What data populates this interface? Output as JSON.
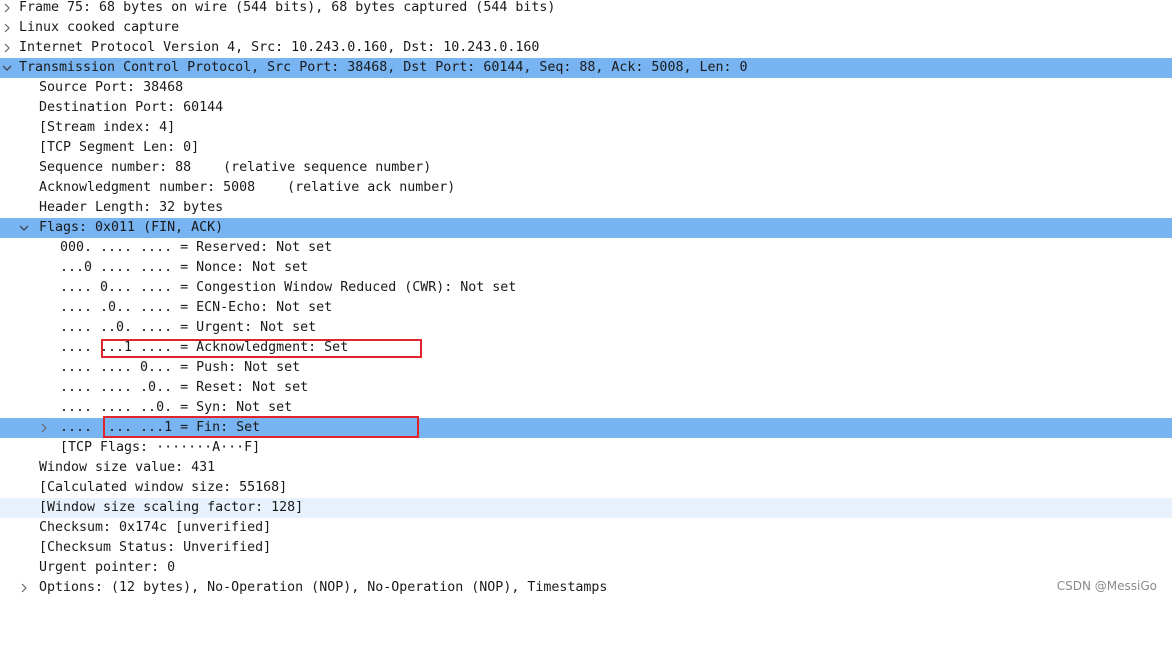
{
  "tree": {
    "frame": "Frame 75: 68 bytes on wire (544 bits), 68 bytes captured (544 bits)",
    "linux_cooked": "Linux cooked capture",
    "ipv4": "Internet Protocol Version 4, Src: 10.243.0.160, Dst: 10.243.0.160",
    "tcp": "Transmission Control Protocol, Src Port: 38468, Dst Port: 60144, Seq: 88, Ack: 5008, Len: 0",
    "source_port": "Source Port: 38468",
    "destination_port": "Destination Port: 60144",
    "stream_index": "[Stream index: 4]",
    "segment_len": "[TCP Segment Len: 0]",
    "sequence_number": "Sequence number: 88    (relative sequence number)",
    "ack_number": "Acknowledgment number: 5008    (relative ack number)",
    "header_length": "Header Length: 32 bytes",
    "flags": "Flags: 0x011 (FIN, ACK)",
    "flag_reserved": "000. .... .... = Reserved: Not set",
    "flag_nonce": "...0 .... .... = Nonce: Not set",
    "flag_cwr": ".... 0... .... = Congestion Window Reduced (CWR): Not set",
    "flag_ecn": ".... .0.. .... = ECN-Echo: Not set",
    "flag_urgent": ".... ..0. .... = Urgent: Not set",
    "flag_ack": ".... ...1 .... = Acknowledgment: Set",
    "flag_push": ".... .... 0... = Push: Not set",
    "flag_reset": ".... .... .0.. = Reset: Not set",
    "flag_syn": ".... .... ..0. = Syn: Not set",
    "flag_fin": ".... .... ...1 = Fin: Set",
    "tcp_flags": "[TCP Flags: ·······A···F]",
    "window_size": "Window size value: 431",
    "calc_window": "[Calculated window size: 55168]",
    "scaling_factor": "[Window size scaling factor: 128]",
    "checksum": "Checksum: 0x174c [unverified]",
    "checksum_status": "[Checksum Status: Unverified]",
    "urgent_pointer": "Urgent pointer: 0",
    "options": "Options: (12 bytes), No-Operation (NOP), No-Operation (NOP), Timestamps"
  },
  "watermark": "CSDN @MessiGo",
  "colors": {
    "selected_row": "#79b4f2",
    "hover_row": "#e8f2fd",
    "annotation_box": "#e0242b"
  },
  "icons": {
    "collapsed": "chevron-right-icon",
    "expanded": "chevron-down-icon"
  }
}
